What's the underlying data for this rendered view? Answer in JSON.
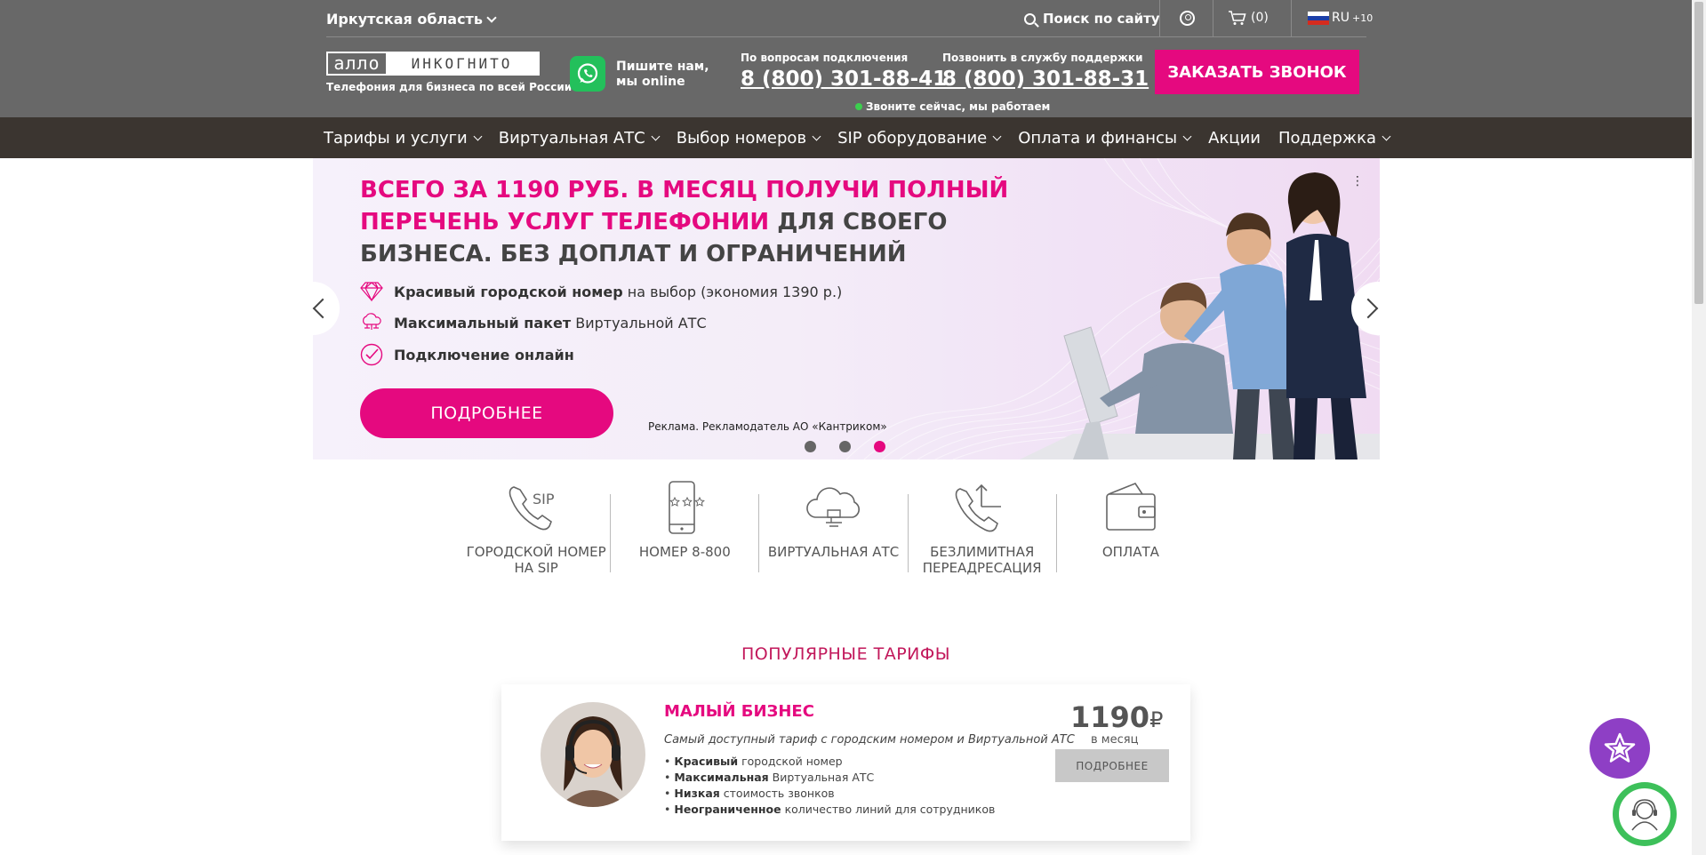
{
  "header": {
    "region": "Иркутская область",
    "search_label": "Поиск по сайту",
    "cart_count": "(0)",
    "lang": "RU",
    "lang_extra": "+10",
    "logo_left": "алло",
    "logo_right": "ИНКОГНИТО",
    "tagline": "Телефония для бизнеса по всей России",
    "whatsapp_text": "Пишите нам, мы online",
    "phone1_label": "По вопросам подключения",
    "phone1": "8 (800) 301-88-41",
    "phone2_label": "Позвонить в службу поддержки",
    "phone2": "8 (800) 301-88-31",
    "online_status": "Звоните сейчас, мы работаем",
    "order_button": "ЗАКАЗАТЬ ЗВОНОК"
  },
  "nav": {
    "items": [
      {
        "label": "Тарифы и услуги",
        "dropdown": true
      },
      {
        "label": "Виртуальная АТС",
        "dropdown": true
      },
      {
        "label": "Выбор номеров",
        "dropdown": true
      },
      {
        "label": "SIP оборудование",
        "dropdown": true
      },
      {
        "label": "Оплата и финансы",
        "dropdown": true
      },
      {
        "label": "Акции",
        "dropdown": false
      },
      {
        "label": "Поддержка",
        "dropdown": true
      }
    ]
  },
  "banner": {
    "title_pink": "ВСЕГО ЗА 1190 РУБ. В МЕСЯЦ ПОЛУЧИ ПОЛНЫЙ ПЕРЕЧЕНЬ УСЛУГ ТЕЛЕФОНИИ",
    "title_dark": " ДЛЯ СВОЕГО БИЗНЕСА. БЕЗ ДОПЛАТ И ОГРАНИЧЕНИЙ",
    "row1_bold": "Красивый городской номер",
    "row1_rest": " на выбор  (экономия 1390 р.)",
    "row2_bold": "Максимальный пакет",
    "row2_rest": " Виртуальной АТС",
    "row3_bold": "Подключение онлайн",
    "button": "ПОДРОБНЕЕ",
    "ad_note": "Реклама. Рекламодатель АО «Кантриком»",
    "slides_total": 3,
    "active_slide": 3
  },
  "services": [
    {
      "label": "ГОРОДСКОЙ НОМЕР НА SIP",
      "icon": "sip-phone-icon"
    },
    {
      "label": "НОМЕР 8-800",
      "icon": "mobile-rating-icon"
    },
    {
      "label": "ВИРТУАЛЬНАЯ АТС",
      "icon": "cloud-pbx-icon"
    },
    {
      "label": "БЕЗЛИМИТНАЯ ПЕРЕАДРЕСАЦИЯ",
      "icon": "call-forward-icon"
    },
    {
      "label": "ОПЛАТА",
      "icon": "wallet-icon"
    }
  ],
  "popular": {
    "title": "ПОПУЛЯРНЫЕ ТАРИФЫ",
    "tariff": {
      "name": "МАЛЫЙ БИЗНЕС",
      "description": "Самый доступный тариф с городским номером и Виртуальной АТС",
      "features": [
        {
          "bold": "Красивый",
          "rest": " городской номер"
        },
        {
          "bold": "Максимальная",
          "rest": " Виртуальная АТС"
        },
        {
          "bold": "Низкая",
          "rest": " стоимость звонков"
        },
        {
          "bold": "Неограниченное",
          "rest": " количество линий для сотрудников"
        }
      ],
      "price": "1190",
      "currency": "₽",
      "period": "в месяц",
      "button": "ПОДРОБНЕЕ"
    }
  },
  "colors": {
    "accent": "#e5097f",
    "header_bg": "#686868",
    "nav_bg": "#3b3530",
    "fab_star": "#8e3fc5",
    "fab_support": "#3dc05a"
  }
}
